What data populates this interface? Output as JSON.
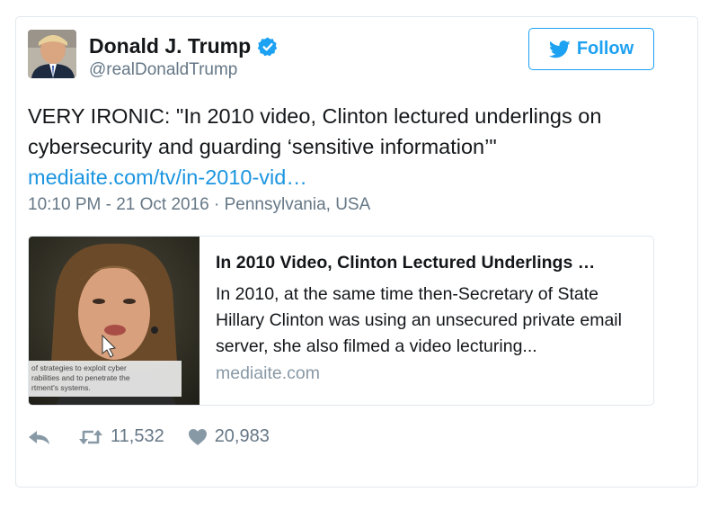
{
  "tweet": {
    "author_name": "Donald J. Trump",
    "author_handle": "@realDonaldTrump",
    "follow_label": "Follow",
    "text_line": "VERY IRONIC: \"In 2010 video, Clinton lectured underlings on cybersecurity and guarding ‘sensitive information’\"",
    "link": "mediaite.com/tv/in-2010-vid…",
    "timestamp": "10:10 PM - 21 Oct 2016",
    "location": "Pennsylvania, USA",
    "meta_separator": "·",
    "retweets": "11,532",
    "likes": "20,983"
  },
  "preview": {
    "title": "In 2010 Video, Clinton Lectured Underlings …",
    "description": "In 2010, at the same time then-Secretary of State Hillary Clinton was using an unsecured private email server, she also filmed a video lecturing...",
    "domain": "mediaite.com",
    "caption_lines": [
      "of strategies to exploit cyber",
      "rabilities and to penetrate the",
      "rtment's systems."
    ]
  },
  "colors": {
    "brand_blue": "#1da1f2",
    "link_blue": "#1b95e0",
    "muted_gray": "#657786"
  },
  "icons": [
    "verified-badge-icon",
    "twitter-bird-icon",
    "reply-icon",
    "retweet-icon",
    "heart-icon"
  ]
}
